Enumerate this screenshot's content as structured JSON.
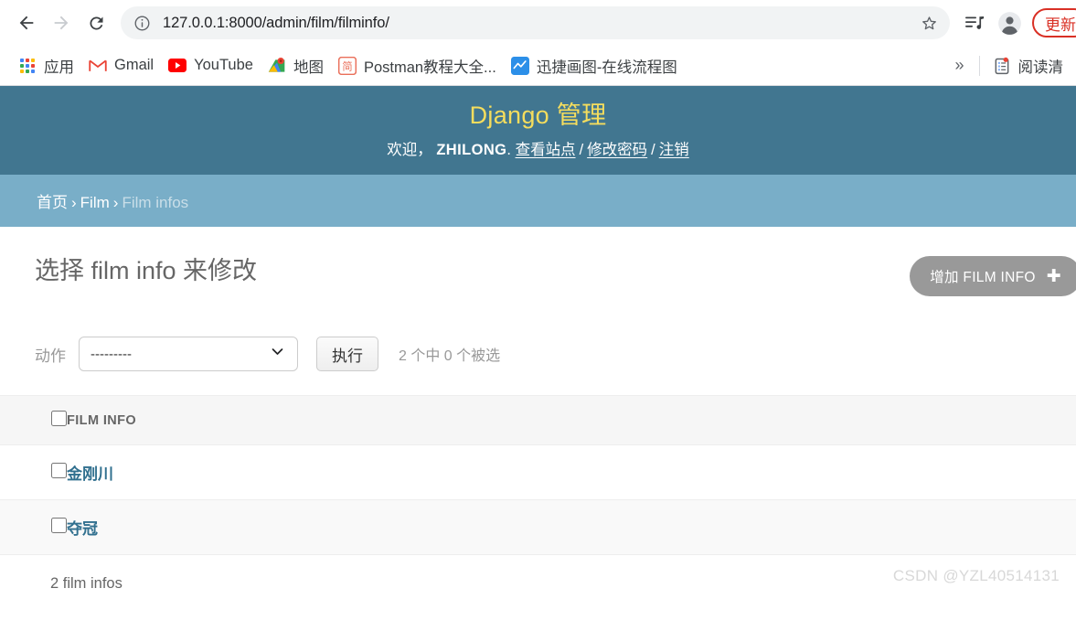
{
  "browser": {
    "back_tooltip": "后退",
    "forward_tooltip": "前进",
    "reload_tooltip": "重新加载",
    "url": "127.0.0.1:8000/admin/film/filminfo/",
    "site_info_icon": "info-circle-icon",
    "star_icon": "bookmark-star-icon",
    "media_icon": "media-control-icon",
    "profile_icon": "profile-avatar-icon",
    "update_button": "更新",
    "update_button_color": "#d93025",
    "overflow_label": "»",
    "bookmarks": [
      {
        "label": "应用",
        "icon": "apps-grid-icon"
      },
      {
        "label": "Gmail",
        "icon": "gmail-icon"
      },
      {
        "label": "YouTube",
        "icon": "youtube-icon"
      },
      {
        "label": "地图",
        "icon": "google-maps-icon"
      },
      {
        "label": "Postman教程大全...",
        "icon": "jianshu-icon"
      },
      {
        "label": "迅捷画图-在线流程图",
        "icon": "xunjie-chart-icon"
      }
    ],
    "reading_list": {
      "label": "阅读清",
      "icon": "reading-list-icon"
    }
  },
  "admin": {
    "site_title": "Django 管理",
    "title_color": "#f5dd5d",
    "header_bg": "#417690",
    "breadcrumb_bg": "#79aec8",
    "welcome_prefix": "欢迎，",
    "username": "ZHILONG",
    "welcome_suffix": ".",
    "user_links": [
      {
        "label": "查看站点"
      },
      {
        "label": "修改密码"
      },
      {
        "label": "注销"
      }
    ],
    "link_separator": "/",
    "breadcrumbs": {
      "home": "首页",
      "app": "Film",
      "current": "Film infos",
      "separator": "›"
    },
    "page_title": "选择 film info 来修改",
    "add_button": {
      "label": "增加 FILM INFO",
      "plus": "✚"
    },
    "action_bar": {
      "label": "动作",
      "selected_option": "---------",
      "options": [
        "---------"
      ],
      "go_label": "执行",
      "selection_counter": "2 个中 0 个被选"
    },
    "table": {
      "columns": [
        "FILM INFO"
      ],
      "rows": [
        {
          "name": "金刚川"
        },
        {
          "name": "夺冠"
        }
      ],
      "link_color": "#31708f"
    },
    "paginator": "2 film infos"
  },
  "watermark": "CSDN @YZL40514131"
}
